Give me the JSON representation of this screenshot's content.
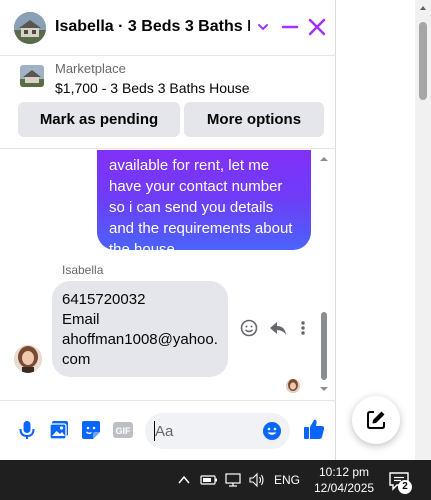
{
  "header": {
    "title": "Isabella · 3 Beds 3 Baths H···",
    "accent_color": "#a033ff"
  },
  "listing": {
    "source": "Marketplace",
    "name": "$1,700 - 3 Beds 3 Baths House",
    "mark_pending_label": "Mark as pending",
    "more_options_label": "More options"
  },
  "thread": {
    "outgoing_lines": [
      "available for rent, let me",
      "have your contact number",
      "so i can send you details",
      "and the requirements about",
      "the house."
    ],
    "sender_name": "Isabella",
    "incoming_lines": [
      "6415720032",
      "Email",
      "ahoffman1008@yahoo.",
      "com"
    ]
  },
  "composer": {
    "placeholder": "Aa",
    "icons": [
      "microphone-icon",
      "photo-icon",
      "sticker-icon",
      "gif-icon",
      "emoji-icon",
      "thumbs-up-icon"
    ]
  },
  "taskbar": {
    "language": "ENG",
    "time": "10:12 pm",
    "date": "12/04/2025",
    "notification_count": "2"
  }
}
